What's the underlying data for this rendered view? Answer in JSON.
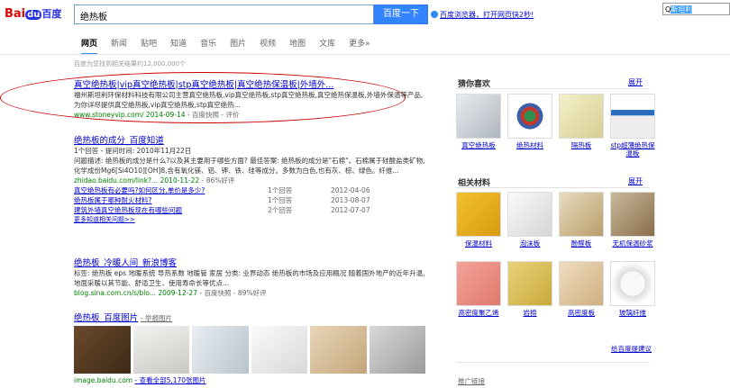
{
  "logo": {
    "bai": "Bai",
    "du": "du",
    "cn": "百度"
  },
  "search": {
    "query": "绝热板",
    "button": "百度一下"
  },
  "promo": "百度浏览器，打开网页快2秒!",
  "topright": {
    "pre": "Q",
    "selected": "斯坦利"
  },
  "nav": [
    "网页",
    "新闻",
    "贴吧",
    "知道",
    "音乐",
    "图片",
    "视频",
    "地图",
    "文库",
    "更多»"
  ],
  "count": "百度为您找到相关结果约12,000,000个",
  "results": [
    {
      "title": "真空绝热板|vip真空绝热板|stp真空绝热板|真空绝热保温板|外墙外...",
      "desc": "福州斯坦利环保材料科技有限公司主营真空绝热板,vip真空绝热板,stp真空绝热板,真空绝热保温板,外墙外保温等产品,为你详尽提供真空绝热板,vip真空绝热板,stp真空绝热...",
      "url": "www.stoneyvip.com/ 2014-09-14",
      "snap": "- 百度快照 - 评价"
    },
    {
      "title": "绝热板的成分_百度知道",
      "meta": "1个回答 - 提问时间: 2010年11月22日",
      "desc": "问题描述: 绝热板的成分是什么?以及其主要用于哪些方面? 最佳答案: 绝热板的成分是\"石棉\"。石棉属于硅酸盐类矿物,化学成份Mg6[Si4O10][OH]8,含有氧化镁、铝、钾、铁、硅等成分。多数为白色,也有灰、棕、绿色。纤维...",
      "url": "zhidao.baidu.com/link?... 2010-11-22",
      "snap": "- 86%好评",
      "subs": [
        {
          "q": "真空绝热板有必要吗?如何区分,单价是多少?",
          "n": "1个回答",
          "d": "2012-04-06"
        },
        {
          "q": "绝热板属于哪种耐火材料?",
          "n": "1个回答",
          "d": "2013-08-07"
        },
        {
          "q": "建筑外墙真空绝热板现在有哪些问题",
          "n": "2个回答",
          "d": "2012-07-07"
        }
      ],
      "more": "更多知道相关问题>>"
    },
    {
      "title": "绝热板_冷暖人间_新浪博客",
      "desc": "标签: 绝热板 eps 地暖系统 导热系数 地暖管 家居 分类: 业界动态 绝热板的市场及应用概况 随着国外地产的近年升温,地面采暖以其节能、舒适卫生、使用寿命长等优点...",
      "url": "blog.sina.com.cn/s/blo... 2009-12-27",
      "snap": "- 百度快照 - 89%好评"
    },
    {
      "title": "绝热板_百度图片",
      "tag": "- 举报图片",
      "url": "image.baidu.com",
      "snap": "- 查看全部5,170张图片"
    }
  ],
  "right": {
    "like_title": "猜你喜欢",
    "like_more": "展开",
    "like": [
      "真空绝热板",
      "绝热材料",
      "隔热板",
      "stp超薄绝热保温板"
    ],
    "rel_title": "相关材料",
    "rel_more": "展开",
    "rel": [
      "保温材料",
      "泡沫板",
      "酚醛板",
      "无机保温砂浆",
      "高密度聚乙烯",
      "岩棉",
      "高密度板",
      "玻璃纤维"
    ],
    "feedback": "给百度提建议",
    "promo_link": "推广链接"
  },
  "colors": {
    "accent": "#3385ff",
    "link": "#0000cc",
    "green": "#008000",
    "highlight": "#cc0000"
  }
}
